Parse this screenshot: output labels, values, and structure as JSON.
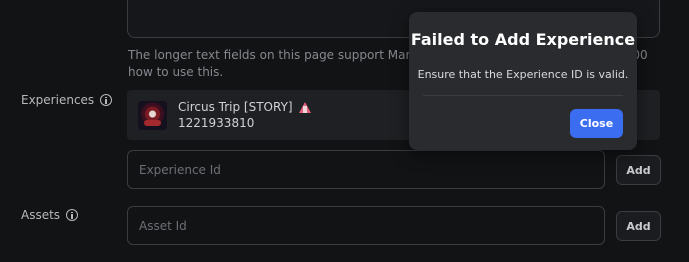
{
  "helper_text": "The longer text fields on this page support Markdown, a... 000 how to use this.",
  "helper_line1": "The longer text fields on this page support Markdown, a",
  "helper_line1_tail": "000",
  "helper_line2": "how to use this.",
  "experiences": {
    "label": "Experiences",
    "items": [
      {
        "title": "Circus Trip [STORY]",
        "id": "1221933810"
      }
    ],
    "input_placeholder": "Experience Id",
    "add_label": "Add"
  },
  "assets": {
    "label": "Assets",
    "input_placeholder": "Asset Id",
    "add_label": "Add"
  },
  "modal": {
    "title": "Failed to Add Experience",
    "message": "Ensure that the Experience ID is valid.",
    "close_label": "Close",
    "accent": "#3a6df0"
  }
}
